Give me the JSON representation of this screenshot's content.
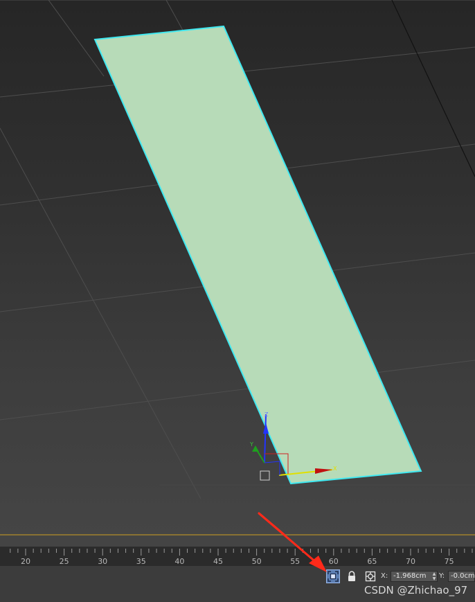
{
  "viewport": {
    "grid_color": "#4e4e4e",
    "plane_fill": "#b7dbb8",
    "plane_edge_color": "#3fe8f0",
    "gizmo_axes": [
      {
        "label": "Z",
        "color": "#2233ff"
      },
      {
        "label": "Y",
        "color": "#1ea01e"
      },
      {
        "label": "X",
        "color": "#e0e000"
      }
    ]
  },
  "annotation": {
    "arrow_color": "#ff2a1a"
  },
  "timeline": {
    "track_line_color": "#8a7233",
    "ruler_labels": [
      "20",
      "25",
      "30",
      "35",
      "40",
      "45",
      "50",
      "55",
      "60",
      "65",
      "70",
      "75"
    ]
  },
  "statusbar": {
    "isolate_icon": "isolate-selection-icon",
    "lock_icon": "lock-icon",
    "absolute_mode_icon": "absolute-transform-icon",
    "x_label": "X:",
    "x_value": "-1.968cm",
    "y_label": "Y:",
    "y_value": "-0.0cm"
  },
  "watermark": "CSDN @Zhichao_97"
}
